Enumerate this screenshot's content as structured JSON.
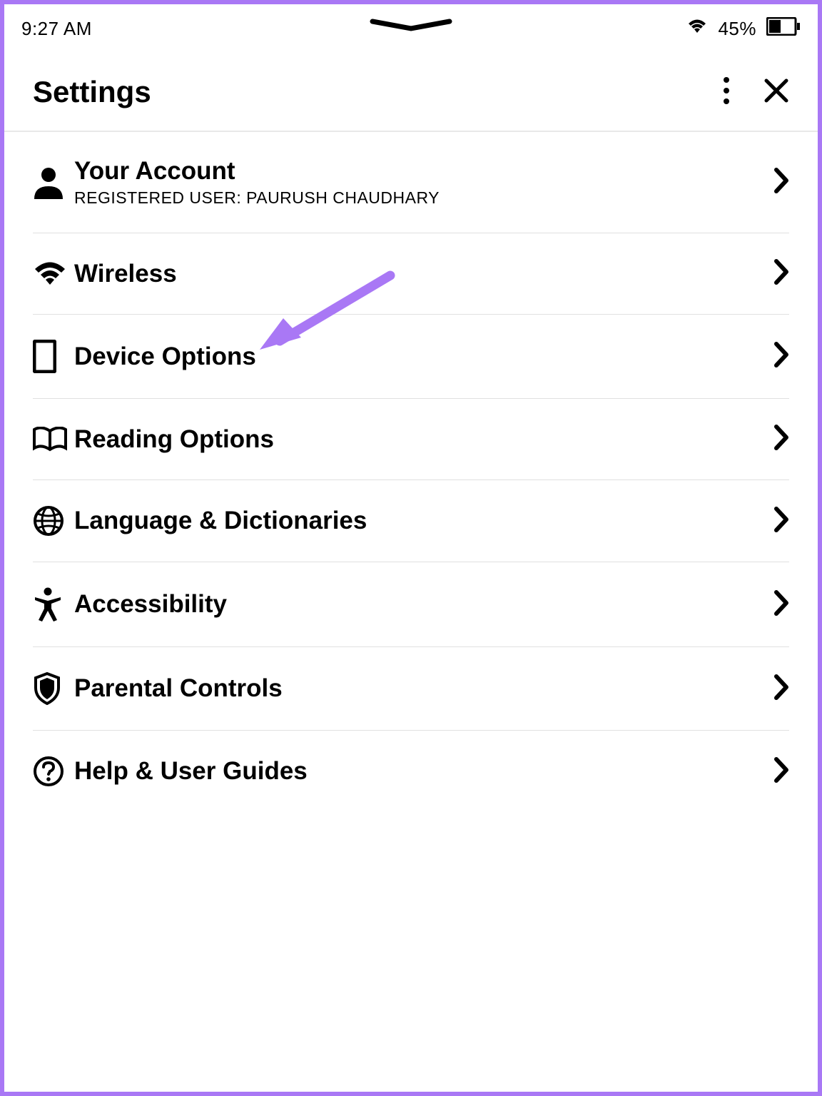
{
  "status": {
    "time": "9:27 AM",
    "battery_percent": "45%"
  },
  "header": {
    "title": "Settings"
  },
  "items": [
    {
      "title": "Your Account",
      "subtitle": "REGISTERED USER: PAURUSH CHAUDHARY",
      "icon": "person"
    },
    {
      "title": "Wireless",
      "subtitle": "",
      "icon": "wifi"
    },
    {
      "title": "Device Options",
      "subtitle": "",
      "icon": "device"
    },
    {
      "title": "Reading Options",
      "subtitle": "",
      "icon": "book"
    },
    {
      "title": "Language & Dictionaries",
      "subtitle": "",
      "icon": "globe"
    },
    {
      "title": "Accessibility",
      "subtitle": "",
      "icon": "accessibility"
    },
    {
      "title": "Parental Controls",
      "subtitle": "",
      "icon": "shield"
    },
    {
      "title": "Help & User Guides",
      "subtitle": "",
      "icon": "help"
    }
  ],
  "annotation": {
    "arrow_color": "#a978f5",
    "target_item_index": 2
  }
}
